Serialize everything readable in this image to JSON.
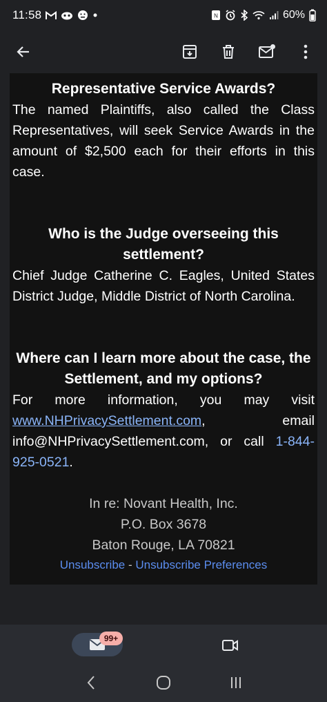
{
  "status_bar": {
    "time": "11:58",
    "battery_percent": "60%",
    "left_icons": [
      "gmail-icon",
      "game-icon",
      "emoji-icon",
      "dot-icon"
    ],
    "right_icons": [
      "nfc-icon",
      "alarm-icon",
      "bluetooth-icon",
      "wifi-icon",
      "signal-icon",
      "battery-icon"
    ]
  },
  "app_bar": {
    "icons": [
      "back-arrow-icon",
      "archive-icon",
      "delete-icon",
      "mark-unread-icon",
      "more-vert-icon"
    ]
  },
  "email": {
    "section1": {
      "heading": "Representative Service Awards?",
      "text": "The named Plaintiffs, also called the Class Representatives, will seek Service Awards in the amount of $2,500 each for their efforts in this case."
    },
    "section2": {
      "heading": "Who is the Judge overseeing this settlement?",
      "text": "Chief Judge Catherine C. Eagles, United States District Judge, Middle District of North Carolina."
    },
    "section3": {
      "heading": "Where can I learn more about the case, the Settlement, and my options?",
      "text_before": "For more information, you may visit ",
      "website": "www.NHPrivacySettlement.com",
      "text_middle": ", email info@NHPrivacySettlement.com, or call ",
      "phone": "1-844-925-0521",
      "text_after": "."
    },
    "footer": {
      "line1": "In re: Novant Health, Inc.",
      "line2": "P.O. Box 3678",
      "line3": "Baton Rouge, LA 70821",
      "unsubscribe": "Unsubscribe",
      "separator": " - ",
      "unsubscribe_prefs": "Unsubscribe Preferences"
    }
  },
  "bottom_bar": {
    "mail_badge": "99+",
    "icons": [
      "mail-icon",
      "video-icon"
    ]
  },
  "colors": {
    "background": "#202124",
    "card": "#121212",
    "link": "#8ab4f8",
    "footer_link": "#5b8def",
    "badge": "#f6aea9"
  }
}
